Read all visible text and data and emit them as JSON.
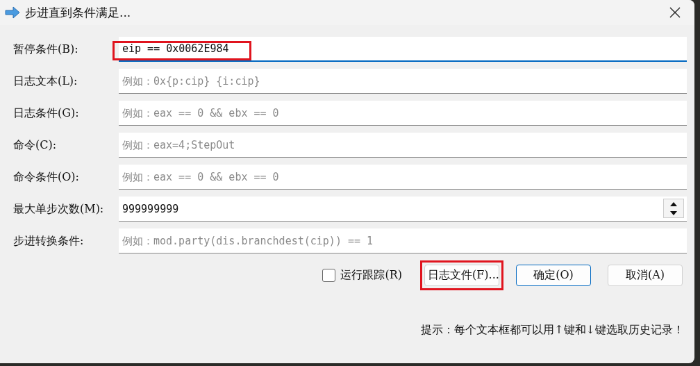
{
  "window": {
    "title": "步进直到条件满足..."
  },
  "fields": [
    {
      "kind": "text",
      "label": "暂停条件(B):",
      "value": "eip == 0x0062E984",
      "focused": true,
      "highlighted": true
    },
    {
      "kind": "text",
      "label": "日志文本(L):",
      "placeholder": "例如：0x{p:cip} {i:cip}",
      "focused": false,
      "highlighted": false
    },
    {
      "kind": "text",
      "label": "日志条件(G):",
      "placeholder": "例如：eax == 0 && ebx == 0",
      "focused": false,
      "highlighted": false
    },
    {
      "kind": "text",
      "label": "命令(C):",
      "placeholder": "例如：eax=4;StepOut",
      "focused": false,
      "highlighted": false
    },
    {
      "kind": "text",
      "label": "命令条件(O):",
      "placeholder": "例如：eax == 0 && ebx == 0",
      "focused": false,
      "highlighted": false
    },
    {
      "kind": "spin",
      "label": "最大单步次数(M):",
      "value": "999999999",
      "focused": false,
      "highlighted": false
    },
    {
      "kind": "text",
      "label": "步进转换条件:",
      "placeholder": "例如：mod.party(dis.branchdest(cip)) == 1",
      "focused": false,
      "highlighted": false
    }
  ],
  "trace_checkbox": {
    "label": "运行跟踪(R)",
    "checked": false
  },
  "buttons": [
    {
      "label": "日志文件(F)...",
      "default": false,
      "highlighted": true
    },
    {
      "label": "确定(O)",
      "default": true,
      "highlighted": false
    },
    {
      "label": "取消(A)",
      "default": false,
      "highlighted": false
    }
  ],
  "hint": "提示：每个文本框都可以用↑键和↓键选取历史记录！"
}
